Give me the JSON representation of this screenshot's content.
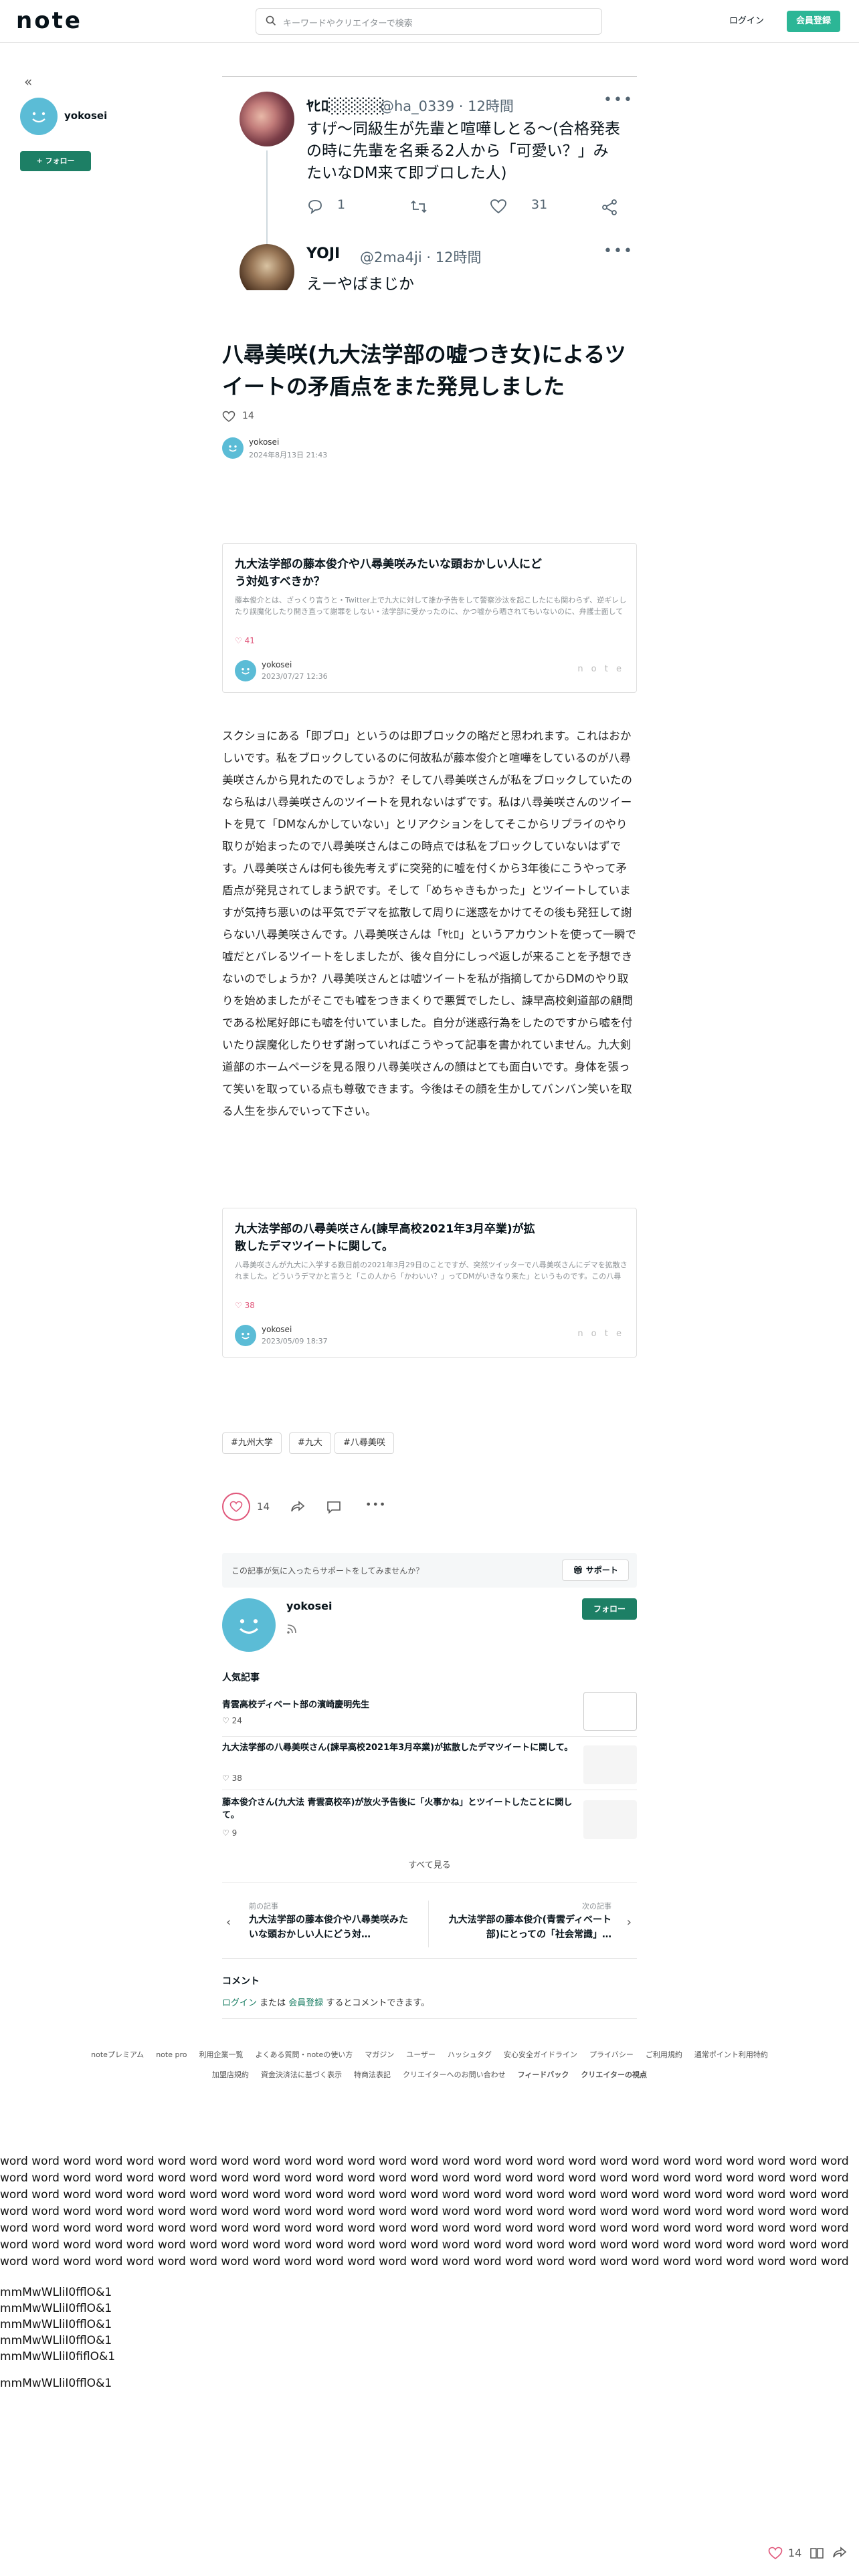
{
  "header": {
    "logo": "note",
    "search_placeholder": "キーワードやクリエイターで検索",
    "login": "ログイン",
    "signup": "会員登録"
  },
  "sidebar": {
    "collapse_glyph": "«",
    "author_name": "yokosei",
    "follow": "+ フォロー"
  },
  "tweet": {
    "first": {
      "name": "ﾔﾋﾛ░░░░░",
      "handle": "@ha_0339 · 12時間",
      "text": "すげ〜同級生が先輩と喧嘩しとる〜(合格発表の時に先輩を名乗る2人から「可愛い？」みたいなDM来て即ブロした人)",
      "replies": "1",
      "likes": "31"
    },
    "second": {
      "name": "YOJI",
      "handle": "@2ma4ji · 12時間",
      "text": "えーやばまじか"
    },
    "more": "•••"
  },
  "article": {
    "title": "八尋美咲(九大法学部の嘘つき女)によるツイートの矛盾点をまた発見しました",
    "likes": "14",
    "author": "yokosei",
    "date": "2024年8月13日 21:43",
    "body": "スクショにある「即ブロ」というのは即ブロックの略だと思われます。これはおかしいです。私をブロックしているのに何故私が藤本俊介と喧嘩をしているのが八尋美咲さんから見れたのでしょうか？そして八尋美咲さんが私をブロックしていたのなら私は八尋美咲さんのツイートを見れないはずです。私は八尋美咲さんのツイートを見て「DMなんかしていない」とリアクションをしてそこからリプライのやり取りが始まったので八尋美咲さんはこの時点では私をブロックしていないはずです。八尋美咲さんは何も後先考えずに突発的に嘘を付くから3年後にこうやって矛盾点が発見されてしまう訳です。そして「めちゃきもかった」とツイートしていますが気持ち悪いのは平気でデマを拡散して周りに迷惑をかけてその後も発狂して謝らない八尋美咲さんです。八尋美咲さんは「ﾔﾋﾛ」というアカウントを使って一瞬で嘘だとバレるツイートをしましたが、後々自分にしっぺ返しが来ることを予想できないのでしょうか？八尋美咲さんとは嘘ツイートを私が指摘してからDMのやり取りを始めましたがそこでも嘘をつきまくりで悪質でしたし、諫早高校剣道部の顧問である松尾好郎にも嘘を付いていました。自分が迷惑行為をしたのですから嘘を付いたり誤魔化したりせず謝っていればこうやって記事を書かれていません。九大剣道部のホームページを見る限り八尋美咲さんの顔はとても面白いです。身体を張って笑いを取っている点も尊敬できます。今後はその顔を生かしてバンバン笑いを取る人生を歩んでいって下さい。",
    "tags": [
      "#九州大学",
      "#九大",
      "#八尋美咲"
    ]
  },
  "cards": [
    {
      "title": "九大法学部の藤本俊介や八尋美咲みたいな頭おかしい人にどう対処すべきか？",
      "desc": "藤本俊介とは、ざっくり言うと・Twitter上で九大に対して誰か予告をして警察沙汰を起こしたにも関わらず、逆ギレしたり誤魔化したり開き直って謝罪をしない・法学部に受かったのに、かつ嘘から晒されてもいないのに、弁護士面してTwitterで様々うじ的外れなアドバイスをして来る・下の字本から…",
      "likes": "41",
      "author": "yokosei",
      "date": "2023/07/27 12:36"
    },
    {
      "title": "九大法学部の八尋美咲さん(諫早高校2021年3月卒業)が拡散したデマツイートに関して。",
      "desc": "八尋美咲さんが九大に入学する数日前の2021年3月29日のことですが、突然ツイッターで八尋美咲さんにデマを拡散されました。どういうデマかと言うと「この人から「かわいい？」ってDMがいきなり来た」というものです。この八尋さんのツイートを見るまで、私は八尋さんを認識していませんでした。DMもしてい…",
      "likes": "38",
      "author": "yokosei",
      "date": "2023/05/09 18:37"
    }
  ],
  "actions": {
    "likes": "14"
  },
  "support": {
    "prompt": "この記事が気に入ったらサポートをしてみませんか？",
    "button": "サポート"
  },
  "author_block": {
    "name": "yokosei",
    "follow": "フォロー"
  },
  "popular": {
    "heading": "人気記事",
    "items": [
      {
        "title": "青雲高校ディベート部の濱崎慶明先生",
        "likes": "24"
      },
      {
        "title": "九大法学部の八尋美咲さん(諫早高校2021年3月卒業)が拡散したデマツイートに関して。",
        "likes": "38"
      },
      {
        "title": "藤本俊介さん(九大法 青雲高校卒)が放火予告後に「火事かね」とツイートしたことに関して。",
        "likes": "9"
      }
    ],
    "see_all": "すべて見る"
  },
  "nav": {
    "prev_label": "前の記事",
    "prev_title": "九大法学部の藤本俊介や八尋美咲みたいな頭おかしい人にどう対…",
    "next_label": "次の記事",
    "next_title": "九大法学部の藤本俊介(青雲ディベート部)にとっての「社会常識」…"
  },
  "comments": {
    "heading": "コメント",
    "login": "ログイン",
    "or": " または ",
    "signup": "会員登録",
    "suffix": " するとコメントできます。"
  },
  "footer": {
    "row1": [
      "noteプレミアム",
      "note pro",
      "利用企業一覧",
      "よくある質問・noteの使い方",
      "マガジン",
      "ユーザー",
      "ハッシュタグ",
      "安心安全ガイドライン",
      "プライバシー",
      "ご利用規約",
      "通常ポイント利用特約"
    ],
    "row2": [
      "加盟店規約",
      "資金決済法に基づく表示",
      "特商法表記",
      "クリエイターへのお問い合わせ",
      "フィードバック",
      "クリエイターの視点"
    ]
  },
  "filler": {
    "words": "word word word word word word word word word word word word word word word word word word word word word word word word word word word word word word word word word word word word word word word word word word word word word word word word word word word word word word word word word word word word word word word word word word word word word word word word word word word word word word word word word word word word word word word word word word word word word word word word word word word word word word word word word word word word word word word word word word word word word word word word word word word word word word word word word word word word word word word word word word word word word word word word word word word word word word word word word word word word word word word word word word word word word word word word word word word word word word word word word word word word word word word word word word word word word word word word word word word word word word word word word word word word word word word word word word word word word word word word word word word word word word word word word word word word word word word word word word word word word word word word word word word word word word word word word word word word word word word word word word word word word word word word word word word word word word word word word word word word word word word word word word word word word word word word word word word word word word word word word word word word word word word word word word word word word word word word word word word word word word word word word word word word word word word word word word",
    "mono_lines": [
      "mmMwWLliI0fflO&1",
      "mmMwWLliI0fflO&1",
      "mmMwWLliI0fflO&1",
      "mmMwWLliI0fflO&1",
      "mmMwWLliI0fiflO&1",
      "mmMwWLliI0fflO&1"
    ]
  },
  "bottom_bar": {
    "likes": "14"
  },
  "colors": {
    "accent": "#2cb696",
    "follow": "#1d7f65",
    "like": "#e0567a",
    "avatar": "#5bbcd6"
  }
}
